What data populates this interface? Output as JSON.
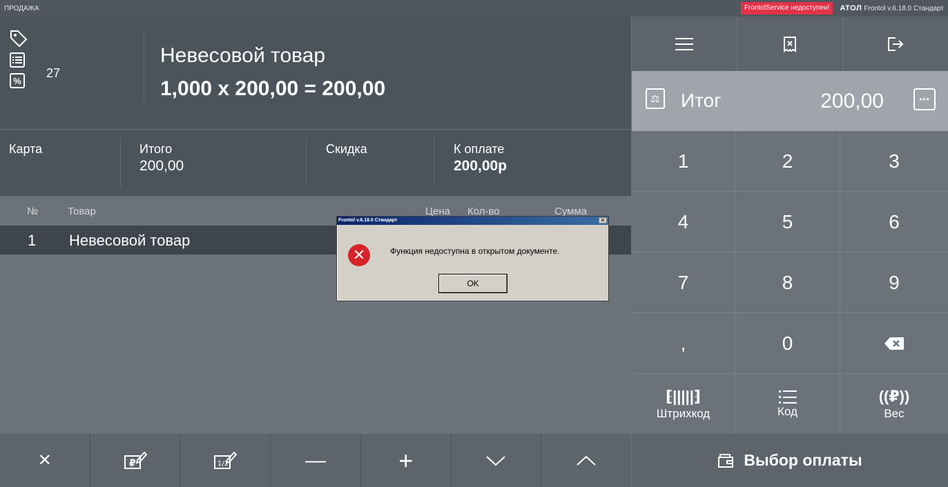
{
  "topbar": {
    "mode": "ПРОДАЖА",
    "service_warning": "FrontolService недоступен!",
    "brand": "ATOЛ",
    "version": "Frontol v.6.18.0 Стандарт"
  },
  "item": {
    "receipt_count": "27",
    "name": "Невесовой товар",
    "formula": "1,000 x 200,00 = 200,00"
  },
  "totals": {
    "card_label": "Карта",
    "subtotal_label": "Итого",
    "subtotal_value": "200,00",
    "discount_label": "Скидка",
    "due_label": "К оплате",
    "due_value": "200,00р"
  },
  "table": {
    "columns": [
      "№",
      "Товар",
      "Цена",
      "Кол-во",
      "Сумма"
    ],
    "rows": [
      {
        "no": "1",
        "name": "Невесовой товар"
      }
    ]
  },
  "right": {
    "total_label": "Итог",
    "total_value": "200,00",
    "keys": [
      "1",
      "2",
      "3",
      "4",
      "5",
      "6",
      "7",
      "8",
      "9",
      ",",
      "0"
    ],
    "barcode_label": "Штрихкод",
    "code_label": "Код",
    "weight_label": "Вес",
    "pay_label": "Выбор оплаты"
  },
  "dialog": {
    "title": "Frontol v.6.18.0 Стандарт",
    "message": "Функция недоступна в открытом документе.",
    "ok_label": "OK"
  },
  "icons": {
    "tag": "tag-icon",
    "list": "list-icon",
    "percent": "percent-icon",
    "menu": "menu-icon",
    "cancel_receipt": "receipt-cancel-icon",
    "logout": "logout-icon",
    "scale": "scale-icon",
    "more": "more-icon",
    "backspace": "backspace-icon",
    "barcode": "barcode-icon",
    "code": "code-list-icon",
    "weight": "weight-icon",
    "wallet": "wallet-icon",
    "error": "error-icon"
  },
  "colors": {
    "warning": "#e3324a",
    "error": "#d8232a",
    "selected_row": "#3e454c",
    "total_panel": "#9fa5ab"
  }
}
